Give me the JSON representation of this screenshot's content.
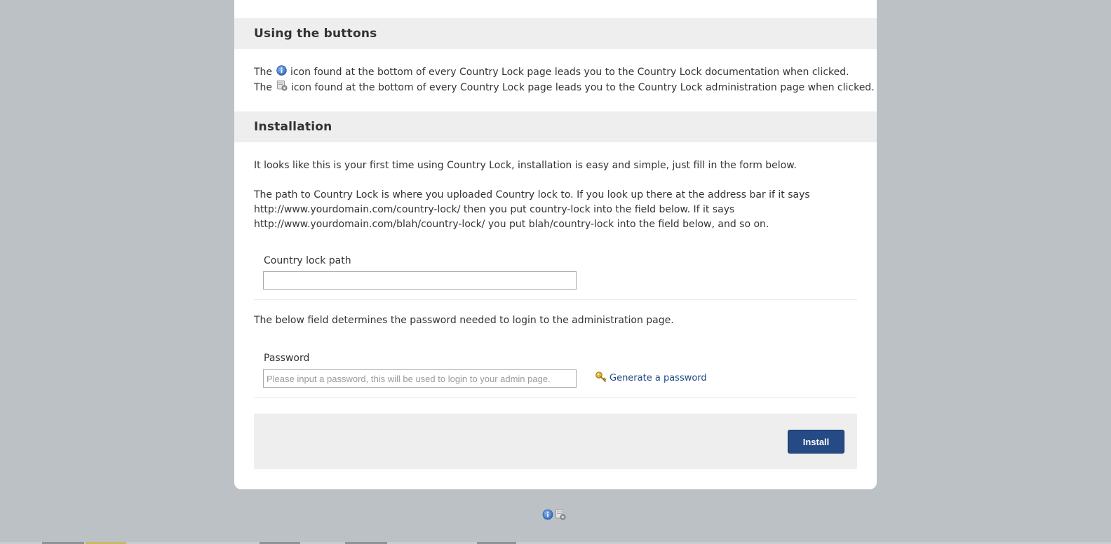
{
  "sections": {
    "buttons": {
      "title": "Using the buttons",
      "line1": {
        "prefix": "The",
        "suffix": "icon found at the bottom of every Country Lock page leads you to the Country Lock documentation when clicked."
      },
      "line2": {
        "prefix": "The",
        "suffix": "icon found at the bottom of every Country Lock page leads you to the Country Lock administration page when clicked."
      }
    },
    "installation": {
      "title": "Installation",
      "intro": "It looks like this is your first time using Country Lock, installation is easy and simple, just fill in the form below.",
      "path_help": [
        "The path to Country Lock is where you uploaded Country lock to. If you look up there at the address bar if it says",
        "http://www.yourdomain.com/country-lock/ then you put country-lock into the field below. If it says",
        "http://www.yourdomain.com/blah/country-lock/ you put blah/country-lock into the field below, and so on."
      ],
      "path_field": {
        "label": "Country lock path",
        "value": "",
        "placeholder": ""
      },
      "password_help": "The below field determines the password needed to login to the administration page.",
      "password_field": {
        "label": "Password",
        "value": "",
        "placeholder": "Please input a password, this will be used to login to your admin page."
      },
      "generate_link": "Generate a password",
      "install_button": "Install"
    }
  },
  "icons": {
    "info": "info-icon",
    "admin": "admin-gear-icon",
    "generate": "key-icon"
  },
  "colors": {
    "background": "#bcc1c6",
    "section_header": "#eeeeee",
    "link": "#1f4a86",
    "button": "#264a85"
  }
}
